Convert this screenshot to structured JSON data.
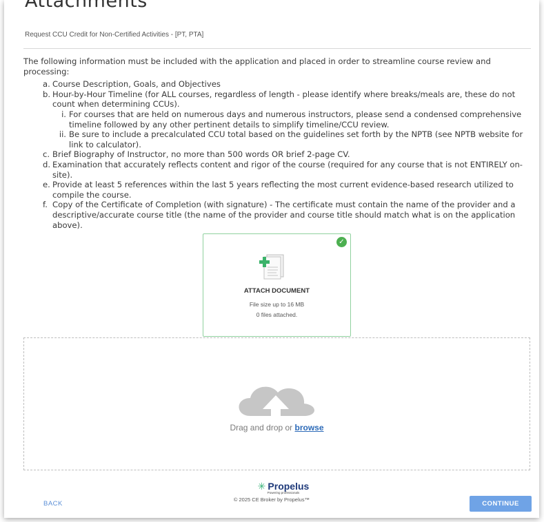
{
  "header": {
    "title": "Attachments",
    "subtitle": "Request CCU Credit for Non-Certified Activities - [PT, PTA]"
  },
  "instructions": {
    "intro": "The following information must be included with the application and placed in order to streamline course review and processing:",
    "items": [
      {
        "marker": "a.",
        "text": "Course Description, Goals, and Objectives"
      },
      {
        "marker": "b.",
        "text": "Hour-by-Hour Timeline (for ALL courses, regardless of length - please identify where breaks/meals are, these do not count when determining CCUs).",
        "sub": [
          {
            "marker": "i.",
            "text": "For courses that are held on numerous days and numerous instructors, please send a condensed comprehensive timeline followed by any other pertinent details to simplify timeline/CCU review."
          },
          {
            "marker": "ii.",
            "text": "Be sure to include a precalculated CCU total based on the guidelines set forth by the NPTB (see NPTB website for link to calculator)."
          }
        ]
      },
      {
        "marker": "c.",
        "text": "Brief Biography of Instructor, no more than 500 words OR brief 2-page CV."
      },
      {
        "marker": "d.",
        "text": "Examination that accurately reflects content and rigor of the course (required for any course that is not ENTIRELY on-site)."
      },
      {
        "marker": "e.",
        "text": "Provide at least 5 references within the last 5 years reflecting the most current evidence-based research utilized to compile the course."
      },
      {
        "marker": "f.",
        "text": "Copy of the Certificate of Completion (with signature) - The certificate must contain the name of the provider and a descriptive/accurate course title (the name of the provider and course title should match what is on the application above)."
      }
    ]
  },
  "attach_card": {
    "label": "ATTACH DOCUMENT",
    "size_note": "File size up to 16 MB",
    "count_note": "0 files attached.",
    "icon": "document-icon",
    "badge_icon": "check-circle-icon"
  },
  "dropzone": {
    "text": "Drag and drop or ",
    "link": "browse",
    "icon": "cloud-upload-icon"
  },
  "footer": {
    "brand": "Propelus",
    "tagline": "Powering professionals",
    "copyright": "© 2025 CE Broker by Propelus™",
    "back_label": "BACK",
    "continue_label": "CONTINUE"
  },
  "colors": {
    "accent": "#6fa3e6",
    "success": "#4caf50",
    "link": "#2c6ab8",
    "brand": "#1f3a7a"
  }
}
